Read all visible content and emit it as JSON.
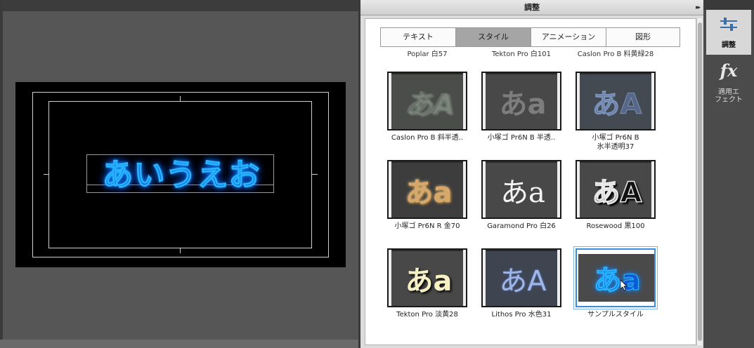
{
  "panel": {
    "title": "調整",
    "menu_glyph": "▸▸",
    "tabs": [
      {
        "label": "テキスト"
      },
      {
        "label": "スタイル"
      },
      {
        "label": "アニメーション"
      },
      {
        "label": "図形"
      }
    ],
    "active_tab": "スタイル"
  },
  "canvas": {
    "text": "あいうえお"
  },
  "styles": {
    "partial_row_labels": [
      "Poplar 白57",
      "Tekton Pro 白101",
      "Caslon Pro B 料黄緑28"
    ],
    "items": [
      {
        "label": "Caslon Pro B 斜半透..",
        "sample": "あA"
      },
      {
        "label": "小塚ゴ Pr6N B 半透..",
        "sample": "あa"
      },
      {
        "label": "小塚ゴ Pr6N B\n氷半透明37",
        "sample": "あA"
      },
      {
        "label": "小塚ゴ Pr6N R 金70",
        "sample": "あa"
      },
      {
        "label": "Garamond Pro 白26",
        "sample": "あa"
      },
      {
        "label": "Rosewood 黒100",
        "sample": "あA"
      },
      {
        "label": "Tekton Pro 淡黄28",
        "sample": "あa"
      },
      {
        "label": "Lithos Pro 水色31",
        "sample": "あA"
      },
      {
        "label": "サンプルスタイル",
        "sample": "あa"
      }
    ],
    "selected": "サンプルスタイル"
  },
  "sidebar": {
    "adjust_label": "調整",
    "effects_label_line1": "適用エ",
    "effects_label_line2": "フェクト",
    "fx_glyph": "fx"
  }
}
